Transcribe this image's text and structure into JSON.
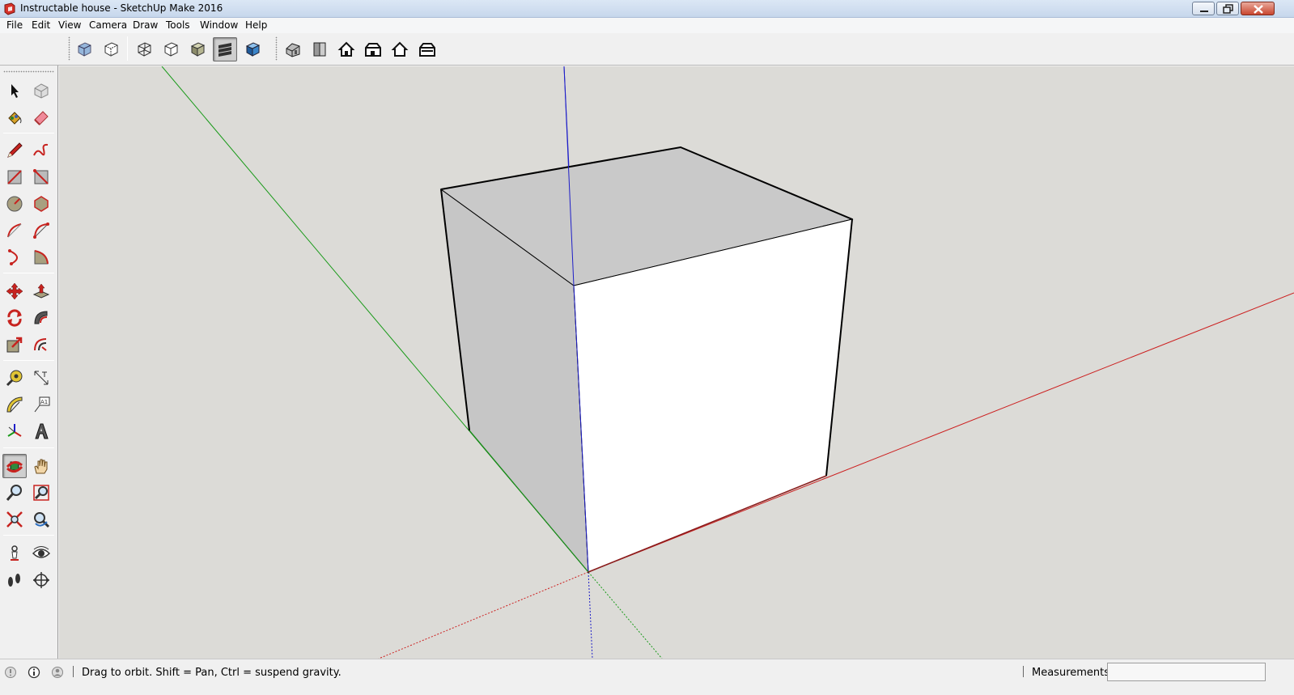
{
  "window": {
    "title": "Instructable house - SketchUp Make 2016",
    "minimize_icon": "minimize-icon",
    "restore_icon": "restore-icon",
    "close_icon": "close-icon"
  },
  "menu": [
    "File",
    "Edit",
    "View",
    "Camera",
    "Draw",
    "Tools",
    "Window",
    "Help"
  ],
  "toolbar": {
    "groups": [
      [
        "xray-style",
        "back-edges-style"
      ],
      [
        "wireframe-style",
        "hidden-line-style",
        "shaded-style",
        "shaded-with-textures-style",
        "monochrome-style"
      ],
      [
        "iso-view",
        "top-view",
        "front-view",
        "right-view",
        "back-view",
        "left-view"
      ]
    ],
    "active": "shaded-with-textures-style"
  },
  "left_tools": [
    [
      "select",
      "make-component"
    ],
    [
      "paint-bucket",
      "eraser"
    ],
    [
      "line",
      "freehand"
    ],
    [
      "rectangle",
      "rotated-rectangle"
    ],
    [
      "circle",
      "polygon"
    ],
    [
      "arc",
      "two-point-arc"
    ],
    [
      "three-point-arc",
      "pie"
    ],
    [
      "move",
      "push-pull"
    ],
    [
      "rotate",
      "follow-me"
    ],
    [
      "scale",
      "offset"
    ],
    [
      "tape-measure",
      "dimension"
    ],
    [
      "protractor",
      "text"
    ],
    [
      "axes",
      "3d-text"
    ],
    [
      "orbit",
      "pan"
    ],
    [
      "zoom",
      "zoom-window"
    ],
    [
      "zoom-extents",
      "previous"
    ],
    [
      "position-camera",
      "look-around"
    ],
    [
      "walk",
      "section-plane"
    ]
  ],
  "active_tool": "orbit",
  "colors": {
    "viewport_bg": "#dcdbd7",
    "axis_red": "#cc1f1f",
    "axis_green": "#199a19",
    "axis_blue": "#1e1ec8",
    "face_front": "#ffffff",
    "face_top": "#c9c9c9",
    "face_left": "#c6c6c6"
  },
  "status": {
    "hint": "Drag to orbit. Shift = Pan, Ctrl = suspend gravity.",
    "measurements_label": "Measurements",
    "measurements_value": ""
  }
}
